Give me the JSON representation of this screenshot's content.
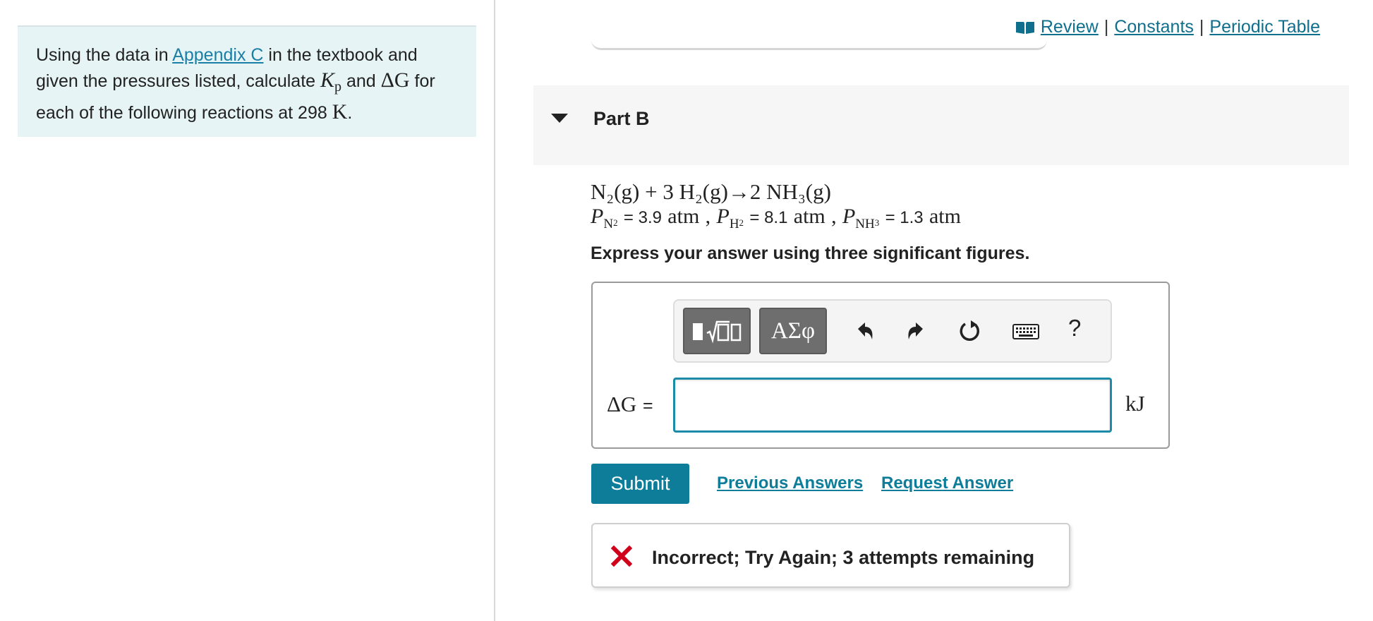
{
  "intro": {
    "text_before_link": "Using the data in ",
    "link": "Appendix C",
    "text_after_link": " in the textbook and given the pressures listed, calculate ",
    "kp_var": "K",
    "kp_sub": "p",
    "and_text": " and ",
    "dg_var": "ΔG",
    "text_end": " for each of the following reactions at 298 ",
    "temp_unit": "K",
    "period": "."
  },
  "top_links": {
    "review": "Review",
    "separator": "|",
    "constants": "Constants",
    "periodic_table": "Periodic Table"
  },
  "part": {
    "title": "Part B"
  },
  "reaction": {
    "equation": "N₂(g) + 3 H₂(g)→2 NH₃(g)"
  },
  "pressures": {
    "p": "P",
    "n2_sub": "N",
    "n2_sub2": "2",
    "n2_value": "= 3.9",
    "h2_sub": "H",
    "h2_sub2": "2",
    "h2_value": "= 8.1",
    "nh3_sub": "NH",
    "nh3_sub2": "3",
    "nh3_value": "= 1.3",
    "unit": "atm",
    "comma": ","
  },
  "instruction": "Express your answer using three significant figures.",
  "toolbar": {
    "greek_label": "ΑΣφ",
    "help_label": "?"
  },
  "answer": {
    "label_var": "ΔG",
    "label_eq": "=",
    "value": "",
    "unit": "kJ"
  },
  "actions": {
    "submit": "Submit",
    "previous_answers": "Previous Answers",
    "request_answer": "Request Answer"
  },
  "feedback": {
    "message": "Incorrect; Try Again; 3 attempts remaining",
    "status_color": "#d0021b"
  },
  "colors": {
    "accent": "#0d7d9a",
    "intro_bg": "#e6f4f5",
    "link": "#1a7fa6"
  }
}
